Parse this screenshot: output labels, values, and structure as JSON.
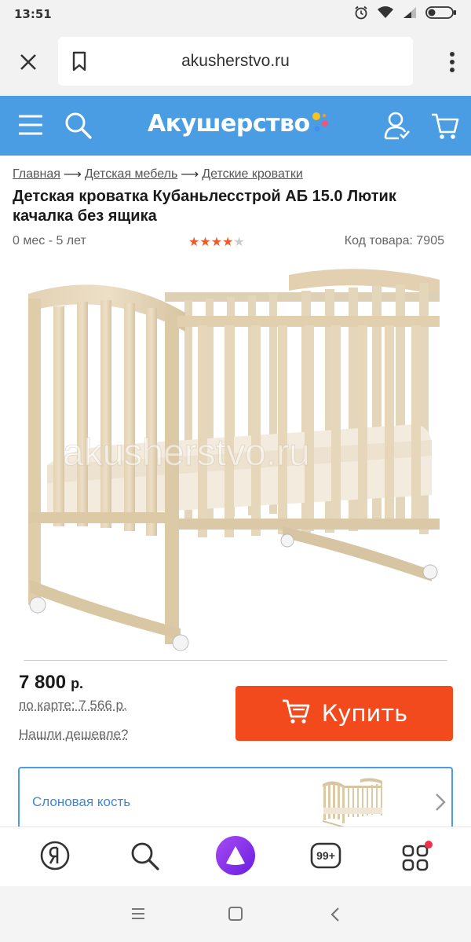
{
  "status_bar": {
    "time": "13:51",
    "icons": [
      "alarm-icon",
      "wifi-icon",
      "signal-icon",
      "battery-icon"
    ]
  },
  "browser": {
    "url": "akusherstvo.ru",
    "icons": [
      "close-icon",
      "bookmark-icon",
      "more-vert-icon"
    ]
  },
  "site_header": {
    "logo_text": "Акушерство",
    "colors": {
      "header_bg": "#4a9de3",
      "dot_yellow": "#f7c21b",
      "dot_blue": "#3f8ff0",
      "dot_pink": "#f0567a",
      "dot_orange": "#f79a22"
    },
    "icons": [
      "menu-icon",
      "search-icon",
      "user-icon",
      "cart-icon"
    ]
  },
  "breadcrumb": {
    "items": [
      "Главная",
      "Детская мебель",
      "Детские кроватки"
    ],
    "separator": "⟶"
  },
  "product": {
    "title": "Детская кроватка Кубаньлесстрой АБ 15.0 Лютик качалка без ящика",
    "age": "0 мес - 5 лет",
    "rating": 4,
    "rating_max": 5,
    "code_label": "Код товара: 7905",
    "watermark": "akusherstvo.ru",
    "price": "7 800",
    "currency": "р.",
    "card_price": "по карте: 7 566 р.",
    "found_cheaper": "Нашли дешевле?",
    "buy_label": "Купить",
    "buy_color": "#f24a1d"
  },
  "variant": {
    "name": "Слоновая кость"
  },
  "bottom_nav": {
    "items": [
      "yandex-icon",
      "search-icon",
      "alice-icon",
      "tabs-icon",
      "apps-icon"
    ],
    "tabs_count": "99+"
  },
  "system_nav": {
    "items": [
      "recent-apps-icon",
      "home-icon",
      "back-icon"
    ]
  }
}
